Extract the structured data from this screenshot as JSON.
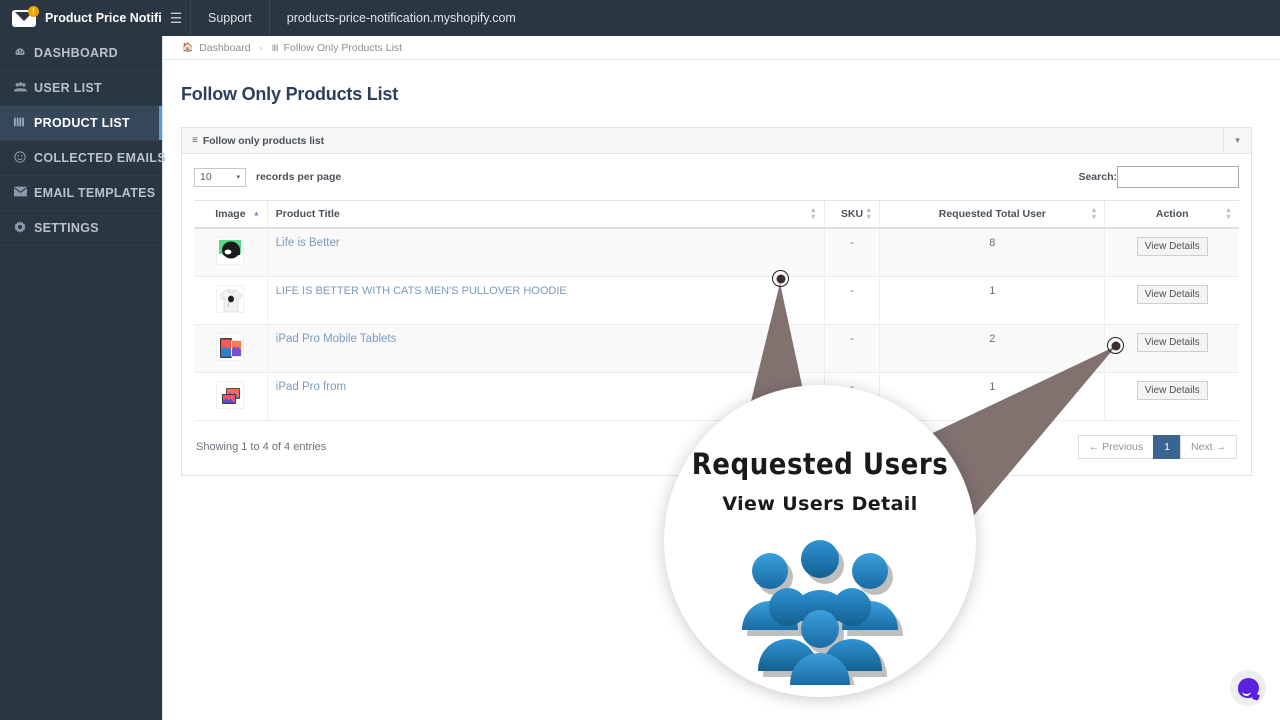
{
  "topbar": {
    "brand_title": "Product Price Notificati…",
    "brand_logo_icon": "envelope-notification-icon",
    "badge_text": "!",
    "menu_toggle_icon": "hamburger-icon",
    "items": [
      {
        "label": "Support",
        "name": "support"
      },
      {
        "label": "products-price-notification.myshopify.com",
        "name": "shop-domain"
      }
    ]
  },
  "sidebar": {
    "items": [
      {
        "label": "DASHBOARD",
        "icon": "dashboard-icon",
        "glyph": "◈",
        "active": false
      },
      {
        "label": "USER LIST",
        "icon": "users-icon",
        "glyph": "▟",
        "active": false
      },
      {
        "label": "PRODUCT LIST",
        "icon": "bars-icon",
        "glyph": "▥",
        "active": true
      },
      {
        "label": "COLLECTED EMAILS",
        "icon": "smile-icon",
        "glyph": "☺",
        "active": false
      },
      {
        "label": "EMAIL TEMPLATES",
        "icon": "envelope-icon",
        "glyph": "✉",
        "active": false
      },
      {
        "label": "SETTINGS",
        "icon": "gear-icon",
        "glyph": "✿",
        "active": false
      }
    ]
  },
  "breadcrumb": {
    "home_icon": "home-icon",
    "home_label": "Dashboard",
    "separator": "›",
    "current_icon": "bars-icon",
    "current_label": "Follow Only Products List"
  },
  "page": {
    "title": "Follow Only Products List"
  },
  "panel": {
    "header_icon": "list-icon",
    "header_title": "Follow only products list",
    "collapse_icon": "chevron-down-icon"
  },
  "controls": {
    "page_length_value": "10",
    "page_length_caret": "▾",
    "page_length_label": "records per page",
    "search_label": "Search:",
    "search_value": "",
    "search_placeholder": ""
  },
  "table": {
    "columns": [
      {
        "label": "Image",
        "sort": "asc",
        "name": "col-image"
      },
      {
        "label": "Product Title",
        "sort": "both",
        "name": "col-product-title"
      },
      {
        "label": "SKU",
        "sort": "both",
        "name": "col-sku"
      },
      {
        "label": "Requested Total User",
        "sort": "both",
        "name": "col-requested-total-user"
      },
      {
        "label": "Action",
        "sort": "both",
        "name": "col-action"
      }
    ],
    "rows": [
      {
        "title": "Life is Better",
        "sku": "-",
        "requested": "8",
        "action": "View Details",
        "thumb": "helmet-thumbnail"
      },
      {
        "title": "LIFE IS BETTER WITH CATS MEN'S PULLOVER HOODIE",
        "sku": "-",
        "requested": "1",
        "action": "View Details",
        "thumb": "hoodie-thumbnail"
      },
      {
        "title": "iPad Pro Mobile Tablets",
        "sku": "-",
        "requested": "2",
        "action": "View Details",
        "thumb": "ipad-thumbnail"
      },
      {
        "title": "iPad Pro from",
        "sku": "-",
        "requested": "1",
        "action": "View Details",
        "thumb": "ipad-stack-thumbnail"
      }
    ],
    "info": "Showing 1 to 4 of 4 entries",
    "pagination": {
      "previous": "← Previous",
      "current": "1",
      "next": "Next →"
    }
  },
  "callout": {
    "title": "Requested Users",
    "subtitle": "View Users Detail",
    "art_icon": "group-of-users-icon"
  },
  "chat_widget": {
    "icon": "chat-bubble-icon"
  },
  "colors": {
    "topbar_bg": "#2b3643",
    "sidebar_bg": "#2b3643",
    "sidebar_active_bg": "#36475a",
    "sidebar_accent": "#5b9bd5",
    "page_title": "#2b3f5c",
    "link": "#7b9bbd",
    "pagination_active": "#3a6591",
    "badge": "#f0a400",
    "chat_bubble": "#5b21e0",
    "callout_cone": "#7a6a68"
  }
}
